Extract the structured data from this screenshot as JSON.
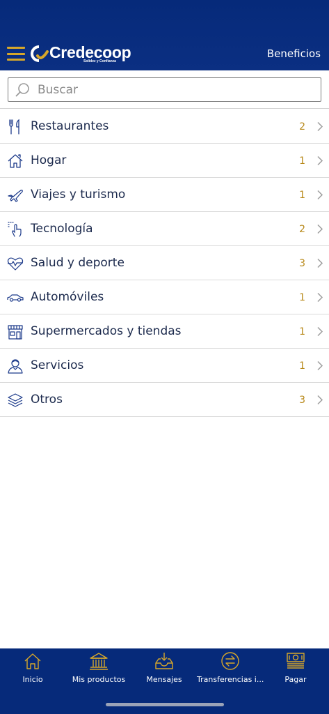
{
  "header": {
    "brand": "Credecoop",
    "tagline": "Solidez y Confianza",
    "title": "Beneficios"
  },
  "search": {
    "placeholder": "Buscar",
    "value": ""
  },
  "categories": [
    {
      "label": "Restaurantes",
      "count": "2",
      "icon": "fork-knife-icon"
    },
    {
      "label": "Hogar",
      "count": "1",
      "icon": "house-icon"
    },
    {
      "label": "Viajes y turismo",
      "count": "1",
      "icon": "airplane-icon"
    },
    {
      "label": "Tecnología",
      "count": "2",
      "icon": "touch-hand-icon"
    },
    {
      "label": "Salud y deporte",
      "count": "3",
      "icon": "heart-pulse-icon"
    },
    {
      "label": "Automóviles",
      "count": "1",
      "icon": "car-icon"
    },
    {
      "label": "Supermercados y tiendas",
      "count": "1",
      "icon": "storefront-icon"
    },
    {
      "label": "Servicios",
      "count": "1",
      "icon": "person-service-icon"
    },
    {
      "label": "Otros",
      "count": "3",
      "icon": "layers-icon"
    }
  ],
  "tabbar": {
    "tabs": [
      {
        "label": "Inicio",
        "icon": "home-icon"
      },
      {
        "label": "Mis productos",
        "icon": "bank-icon"
      },
      {
        "label": "Mensajes",
        "icon": "inbox-icon"
      },
      {
        "label": "Transferencias i...",
        "icon": "transfer-arrows-icon"
      },
      {
        "label": "Pagar",
        "icon": "cash-payment-icon"
      }
    ]
  },
  "colors": {
    "header_bg": "#062a7a",
    "accent_gold": "#d7a72a",
    "count_gold": "#b8891a",
    "text_dark": "#1c2a4d"
  }
}
